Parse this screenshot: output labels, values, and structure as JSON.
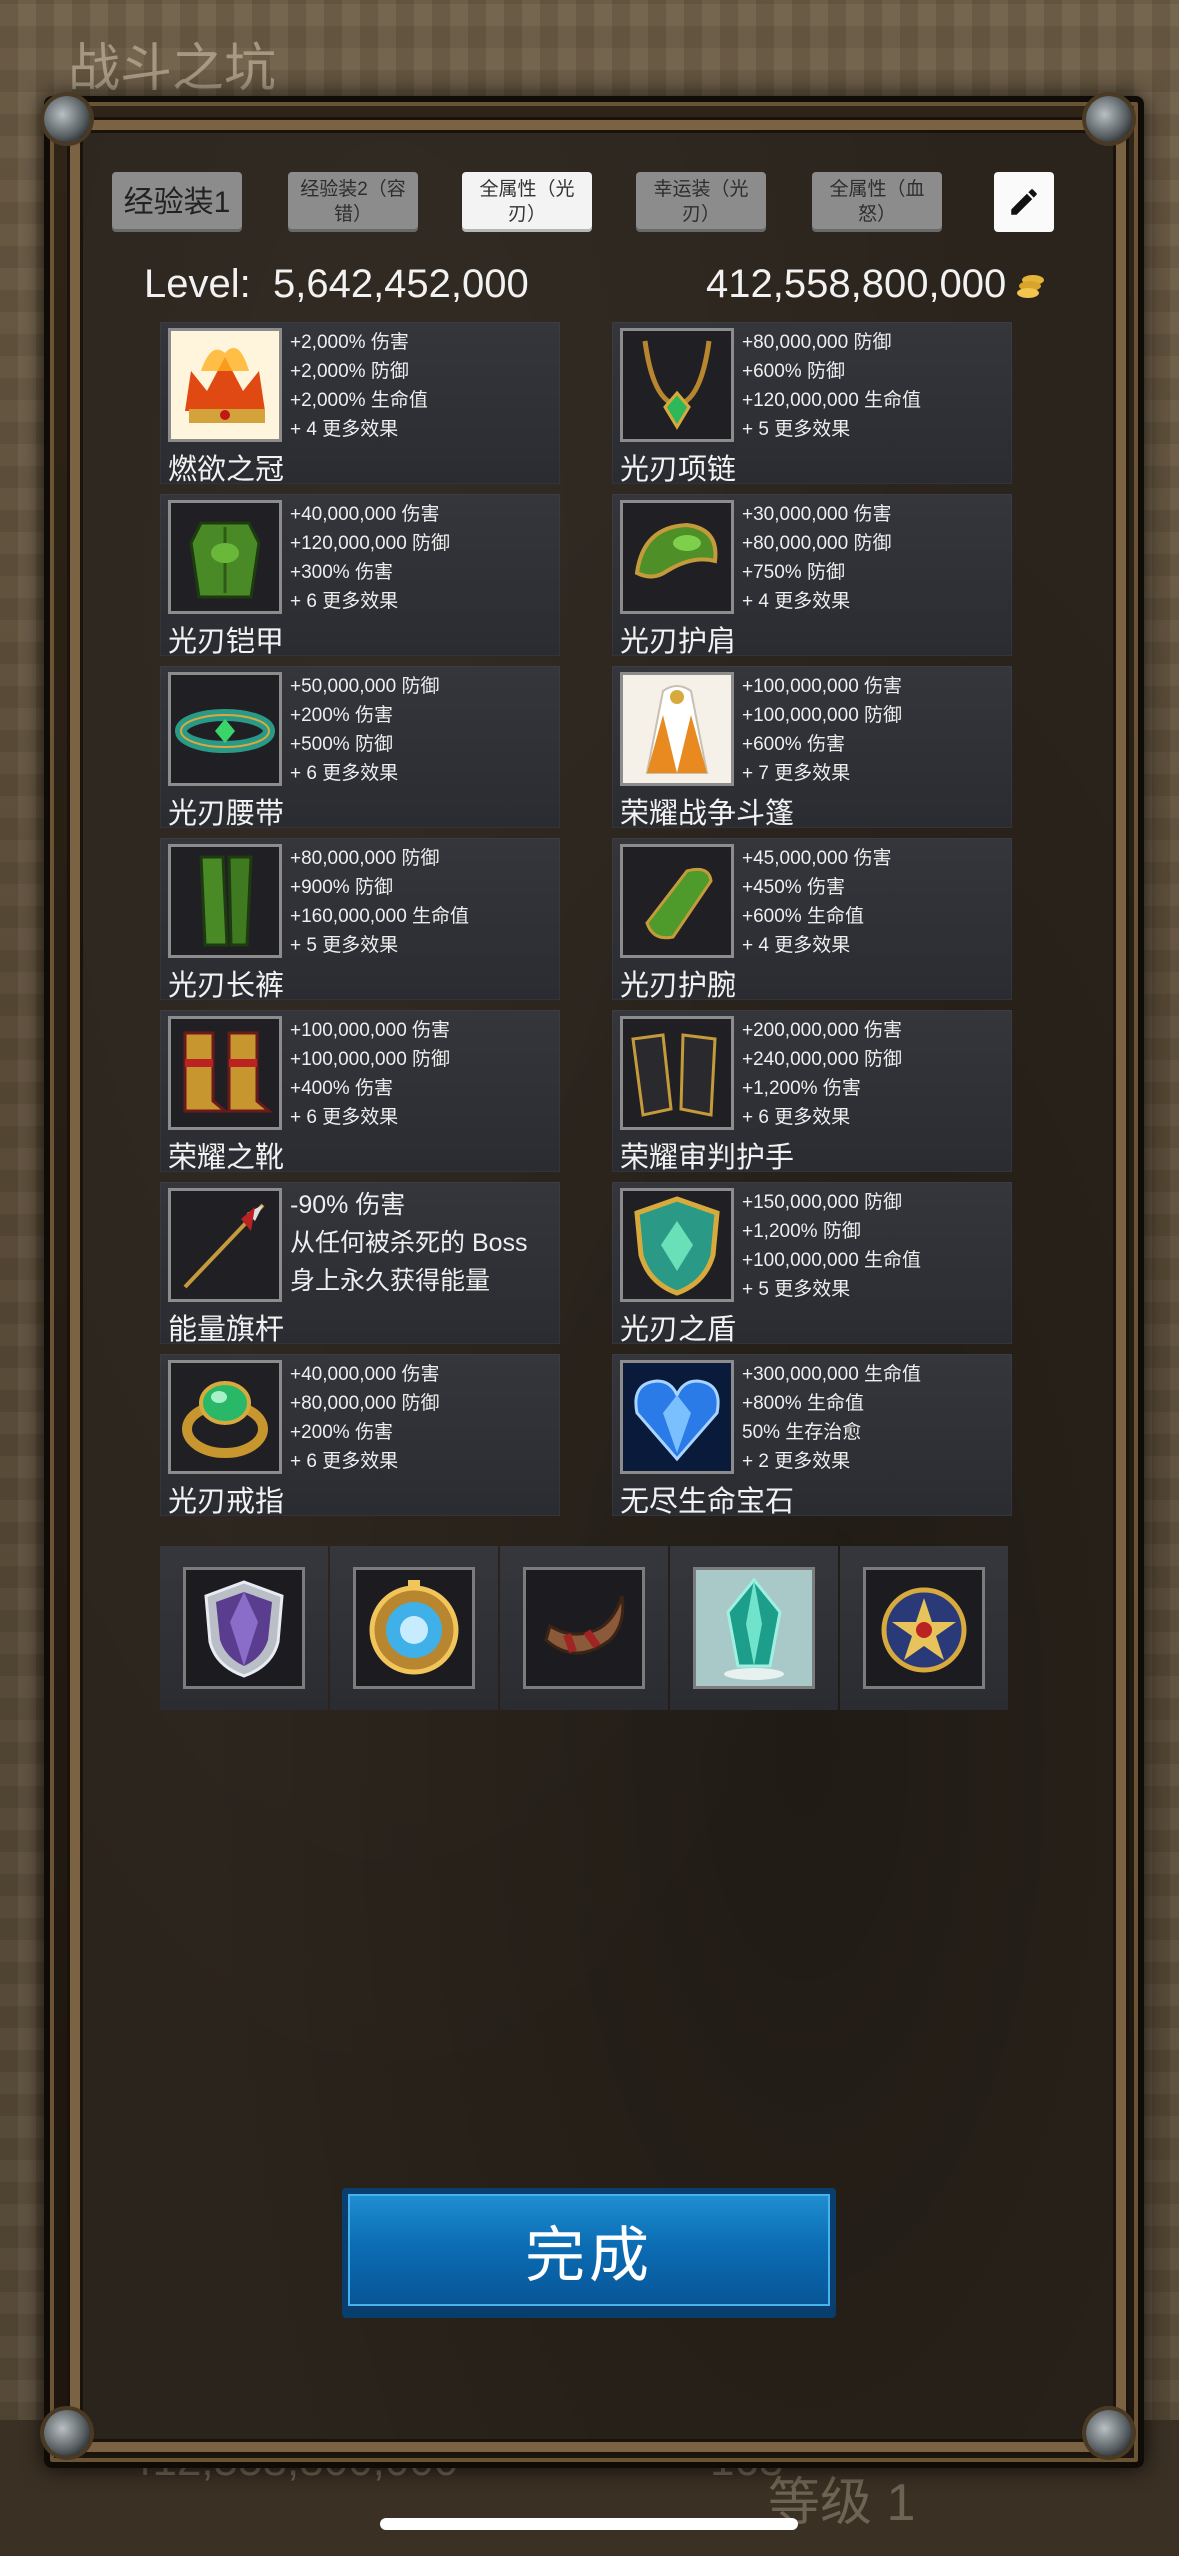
{
  "background": {
    "title": "战斗之坑",
    "gold_display": "412,558,800,000",
    "gem_display": "163",
    "level_display": "等级 1"
  },
  "tabs": [
    {
      "label": "经验装1",
      "active": false
    },
    {
      "label": "经验装2（容错）",
      "active": false
    },
    {
      "label": "全属性（光刃）",
      "active": true
    },
    {
      "label": "幸运装（光刃）",
      "active": false
    },
    {
      "label": "全属性（血怒）",
      "active": false
    }
  ],
  "header": {
    "level": "Level:  5,642,452,000",
    "gold": "412,558,800,000"
  },
  "items": [
    {
      "name": "燃欲之冠",
      "icon": "flaming-crown-icon",
      "stats": [
        "+2,000% 伤害",
        "+2,000% 防御",
        "+2,000% 生命值",
        "+ 4 更多效果"
      ]
    },
    {
      "name": "光刃项链",
      "icon": "emerald-necklace-icon",
      "stats": [
        "+80,000,000 防御",
        "+600% 防御",
        "+120,000,000 生命值",
        "+ 5 更多效果"
      ]
    },
    {
      "name": "光刃铠甲",
      "icon": "green-armor-icon",
      "stats": [
        "+40,000,000 伤害",
        "+120,000,000 防御",
        "+300% 伤害",
        "+ 6 更多效果"
      ]
    },
    {
      "name": "光刃护肩",
      "icon": "green-pauldron-icon",
      "stats": [
        "+30,000,000 伤害",
        "+80,000,000 防御",
        "+750% 防御",
        "+ 4 更多效果"
      ]
    },
    {
      "name": "光刃腰带",
      "icon": "jade-belt-icon",
      "stats": [
        "+50,000,000 防御",
        "+200% 伤害",
        "+500% 防御",
        "+ 6 更多效果"
      ]
    },
    {
      "name": "荣耀战争斗篷",
      "icon": "white-cloak-icon",
      "stats": [
        "+100,000,000 伤害",
        "+100,000,000 防御",
        "+600% 伤害",
        "+ 7 更多效果"
      ]
    },
    {
      "name": "光刃长裤",
      "icon": "green-greaves-icon",
      "stats": [
        "+80,000,000 防御",
        "+900% 防御",
        "+160,000,000 生命值",
        "+ 5 更多效果"
      ]
    },
    {
      "name": "光刃护腕",
      "icon": "green-bracer-icon",
      "stats": [
        "+45,000,000 伤害",
        "+450% 伤害",
        "+600% 生命值",
        "+ 4 更多效果"
      ]
    },
    {
      "name": "荣耀之靴",
      "icon": "golden-boots-icon",
      "stats": [
        "+100,000,000 伤害",
        "+100,000,000 防御",
        "+400% 伤害",
        "+ 6 更多效果"
      ]
    },
    {
      "name": "荣耀审判护手",
      "icon": "dark-gauntlets-icon",
      "stats": [
        "+200,000,000 伤害",
        "+240,000,000 防御",
        "+1,200% 伤害",
        "+ 6 更多效果"
      ]
    },
    {
      "name": "能量旗杆",
      "icon": "banner-spear-icon",
      "stats": [
        "-90% 伤害",
        "从任何被杀死的 Boss",
        "身上永久获得能量"
      ],
      "big": true
    },
    {
      "name": "光刃之盾",
      "icon": "jade-shield-icon",
      "stats": [
        "+150,000,000 防御",
        "+1,200% 防御",
        "+100,000,000 生命值",
        "+ 5 更多效果"
      ]
    },
    {
      "name": "光刃戒指",
      "icon": "emerald-ring-icon",
      "stats": [
        "+40,000,000 伤害",
        "+80,000,000 防御",
        "+200% 伤害",
        "+ 6 更多效果"
      ]
    },
    {
      "name": "无尽生命宝石",
      "icon": "blue-heart-gem-icon",
      "stats": [
        "+300,000,000 生命值",
        "+800% 生命值",
        "50% 生存治愈",
        "+ 2 更多效果"
      ]
    }
  ],
  "accessories": [
    {
      "icon": "crystal-shield-icon"
    },
    {
      "icon": "golden-compass-icon"
    },
    {
      "icon": "war-horn-icon"
    },
    {
      "icon": "teal-crystal-icon"
    },
    {
      "icon": "royal-emblem-icon"
    }
  ],
  "done_button": "完成",
  "colors": {
    "accent_blue": "#0c6db4",
    "tab_active": "#f3f3f3",
    "tab_inactive": "#8c8c8c"
  }
}
